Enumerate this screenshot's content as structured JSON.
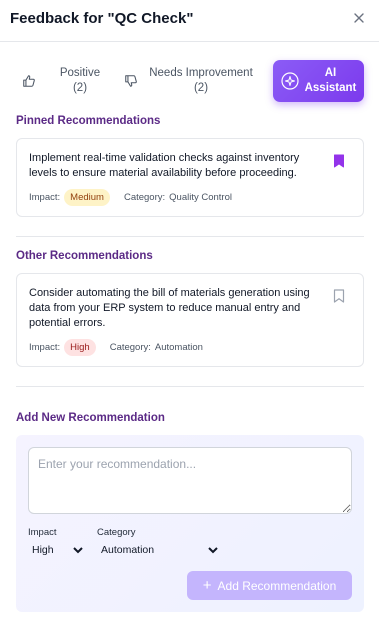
{
  "header": {
    "title": "Feedback for \"QC Check\""
  },
  "tabs": [
    {
      "label_line1": "Positive",
      "label_line2": "(2)",
      "icon": "thumbs-up-icon"
    },
    {
      "label_line1": "Needs Improvement",
      "label_line2": "(2)",
      "icon": "thumbs-down-icon"
    },
    {
      "label_line1": "AI",
      "label_line2": "Assistant",
      "icon": "sparkle-icon"
    }
  ],
  "pinned": {
    "title": "Pinned Recommendations",
    "items": [
      {
        "text": "Implement real-time validation checks against inventory levels to ensure material availability before proceeding.",
        "impact_label": "Impact:",
        "impact": "Medium",
        "category_label": "Category:",
        "category": "Quality Control"
      }
    ]
  },
  "other": {
    "title": "Other Recommendations",
    "items": [
      {
        "text": "Consider automating the bill of materials generation using data from your ERP system to reduce manual entry and potential errors.",
        "impact_label": "Impact:",
        "impact": "High",
        "category_label": "Category:",
        "category": "Automation"
      }
    ]
  },
  "add": {
    "title": "Add New Recommendation",
    "placeholder": "Enter your recommendation...",
    "impact_label": "Impact",
    "impact_value": "High",
    "category_label": "Category",
    "category_value": "Automation",
    "button_label": "Add Recommendation"
  },
  "colors": {
    "accent": "#7c3aed",
    "section_title": "#5b2a86",
    "pinned_bookmark": "#9333ea"
  }
}
